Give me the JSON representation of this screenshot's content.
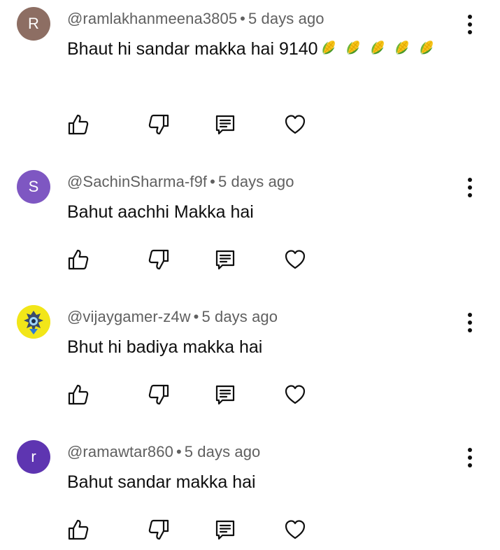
{
  "comments": [
    {
      "avatar_letter": "R",
      "avatar_color": "#8d6e63",
      "handle": "@ramlakhanmeena3805",
      "time": "5 days ago",
      "text": "Bhaut hi sandar makka hai 9140"
    },
    {
      "avatar_letter": "S",
      "avatar_color": "#7e57c2",
      "handle": "@SachinSharma-f9f",
      "time": "5 days ago",
      "text": "Bahut aachhi Makka hai"
    },
    {
      "avatar_letter": "",
      "avatar_color": "#f2e619",
      "handle": "@vijaygamer-z4w",
      "time": "5 days ago",
      "text": "Bhut hi badiya makka hai"
    },
    {
      "avatar_letter": "r",
      "avatar_color": "#5e35b1",
      "handle": "@ramawtar860",
      "time": "5 days ago",
      "text": "Bahut sandar makka hai"
    }
  ],
  "separator": "•",
  "icons": {
    "like": "thumbs-up-icon",
    "dislike": "thumbs-down-icon",
    "reply": "reply-comment-icon",
    "heart": "heart-icon",
    "more": "more-vert-icon",
    "emoji": "corn-emoji-icon"
  }
}
